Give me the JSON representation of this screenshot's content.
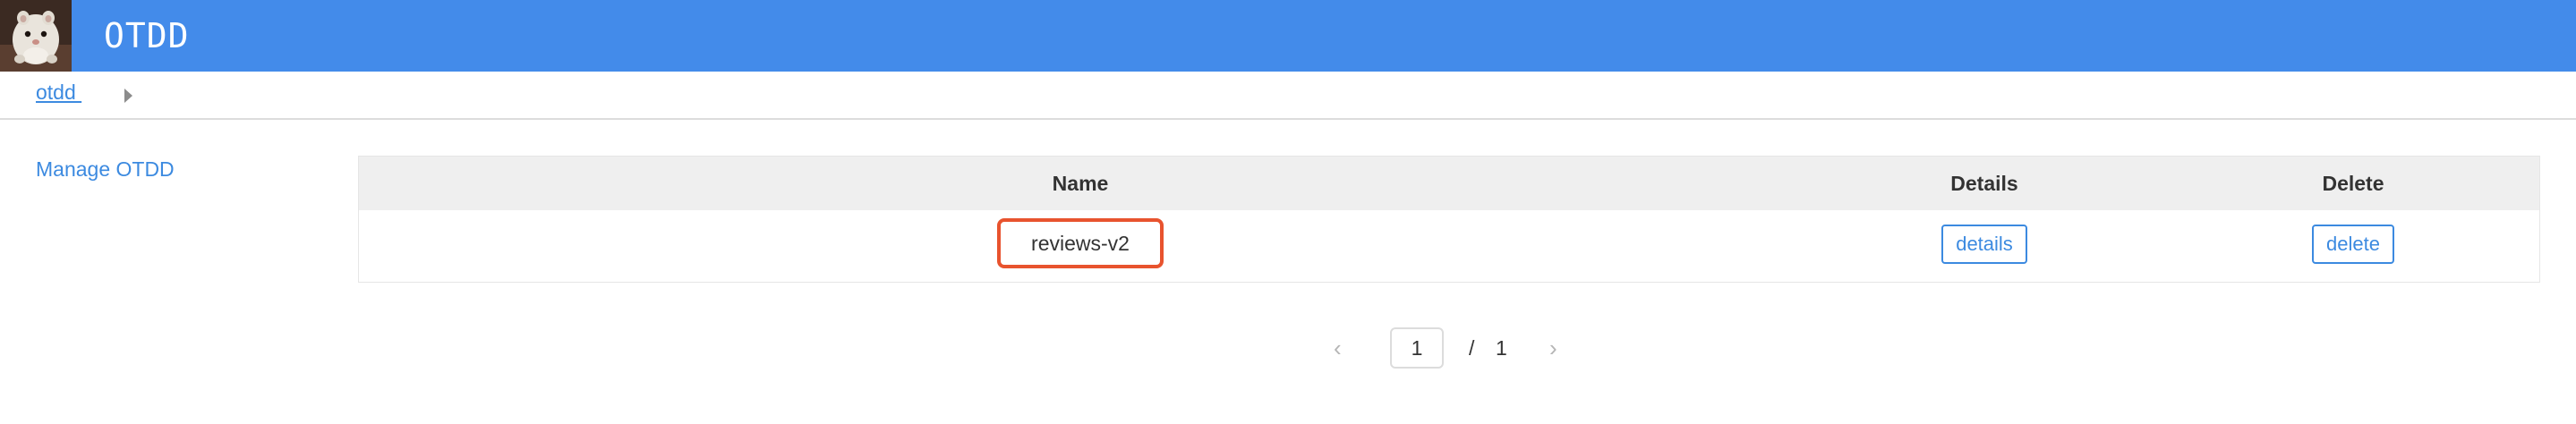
{
  "header": {
    "logo_icon": "hamster-avatar-icon",
    "title": "OTDD",
    "background_color": "#438bea"
  },
  "breadcrumb": {
    "items": [
      {
        "label": "otdd "
      }
    ],
    "separator_icon": "caret-right-icon"
  },
  "sidebar": {
    "items": [
      {
        "label": "Manage OTDD"
      }
    ]
  },
  "table": {
    "columns": [
      "Name",
      "Details",
      "Delete"
    ],
    "rows": [
      {
        "name": "reviews-v2",
        "details_label": "details",
        "delete_label": "delete"
      }
    ],
    "highlight_color": "#e8532e"
  },
  "pagination": {
    "prev_icon": "chevron-left-icon",
    "next_icon": "chevron-right-icon",
    "current_page": "1",
    "separator": "/",
    "total_pages": "1"
  },
  "colors": {
    "accent": "#3c8ae0",
    "header_bg": "#438bea",
    "table_header_bg": "#efefef"
  }
}
